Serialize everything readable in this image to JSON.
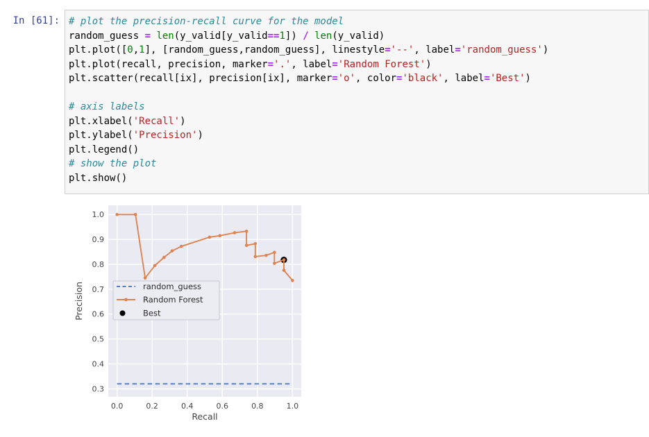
{
  "notebook": {
    "prompt": "In [61]:",
    "code_lines": [
      [
        {
          "t": "comment",
          "s": "# plot the precision-recall curve for the model"
        }
      ],
      [
        {
          "t": "plain",
          "s": "random_guess "
        },
        {
          "t": "op",
          "s": "="
        },
        {
          "t": "plain",
          "s": " "
        },
        {
          "t": "builtin",
          "s": "len"
        },
        {
          "t": "plain",
          "s": "(y_valid[y_valid"
        },
        {
          "t": "op",
          "s": "=="
        },
        {
          "t": "num",
          "s": "1"
        },
        {
          "t": "plain",
          "s": "]) "
        },
        {
          "t": "op",
          "s": "/"
        },
        {
          "t": "plain",
          "s": " "
        },
        {
          "t": "builtin",
          "s": "len"
        },
        {
          "t": "plain",
          "s": "(y_valid)"
        }
      ],
      [
        {
          "t": "plain",
          "s": "plt.plot(["
        },
        {
          "t": "num",
          "s": "0"
        },
        {
          "t": "plain",
          "s": ","
        },
        {
          "t": "num",
          "s": "1"
        },
        {
          "t": "plain",
          "s": "], [random_guess,random_guess], linestyle"
        },
        {
          "t": "op",
          "s": "="
        },
        {
          "t": "str",
          "s": "'--'"
        },
        {
          "t": "plain",
          "s": ", label"
        },
        {
          "t": "op",
          "s": "="
        },
        {
          "t": "str",
          "s": "'random_guess'"
        },
        {
          "t": "plain",
          "s": ")"
        }
      ],
      [
        {
          "t": "plain",
          "s": "plt.plot(recall, precision, marker"
        },
        {
          "t": "op",
          "s": "="
        },
        {
          "t": "str",
          "s": "'.'"
        },
        {
          "t": "plain",
          "s": ", label"
        },
        {
          "t": "op",
          "s": "="
        },
        {
          "t": "str",
          "s": "'Random Forest'"
        },
        {
          "t": "plain",
          "s": ")"
        }
      ],
      [
        {
          "t": "plain",
          "s": "plt.scatter(recall[ix], precision[ix], marker"
        },
        {
          "t": "op",
          "s": "="
        },
        {
          "t": "str",
          "s": "'o'"
        },
        {
          "t": "plain",
          "s": ", color"
        },
        {
          "t": "op",
          "s": "="
        },
        {
          "t": "str",
          "s": "'black'"
        },
        {
          "t": "plain",
          "s": ", label"
        },
        {
          "t": "op",
          "s": "="
        },
        {
          "t": "str",
          "s": "'Best'"
        },
        {
          "t": "plain",
          "s": ")"
        }
      ],
      [],
      [
        {
          "t": "comment",
          "s": "# axis labels"
        }
      ],
      [
        {
          "t": "plain",
          "s": "plt.xlabel("
        },
        {
          "t": "str",
          "s": "'Recall'"
        },
        {
          "t": "plain",
          "s": ")"
        }
      ],
      [
        {
          "t": "plain",
          "s": "plt.ylabel("
        },
        {
          "t": "str",
          "s": "'Precision'"
        },
        {
          "t": "plain",
          "s": ")"
        }
      ],
      [
        {
          "t": "plain",
          "s": "plt.legend()"
        }
      ],
      [
        {
          "t": "comment",
          "s": "# show the plot"
        }
      ],
      [
        {
          "t": "plain",
          "s": "plt.show()"
        }
      ]
    ]
  },
  "chart_data": {
    "type": "line",
    "title": "",
    "xlabel": "Recall",
    "ylabel": "Precision",
    "xlim": [
      -0.05,
      1.05
    ],
    "ylim": [
      0.268,
      1.037
    ],
    "x_ticks": [
      0.0,
      0.2,
      0.4,
      0.6,
      0.8,
      1.0
    ],
    "y_ticks": [
      0.3,
      0.4,
      0.5,
      0.6,
      0.7,
      0.8,
      0.9,
      1.0
    ],
    "grid": true,
    "axes_background": "#eaeaf2",
    "grid_color": "#ffffff",
    "tick_color": "#444444",
    "series": [
      {
        "name": "random_guess",
        "style": "dashed",
        "color": "#5a7fc2",
        "x": [
          0,
          1
        ],
        "y": [
          0.32,
          0.32
        ]
      },
      {
        "name": "Random Forest",
        "style": "line-marker",
        "color": "#dd8452",
        "points": [
          [
            0.0,
            1.0
          ],
          [
            0.105,
            1.0
          ],
          [
            0.16,
            0.745
          ],
          [
            0.215,
            0.795
          ],
          [
            0.268,
            0.828
          ],
          [
            0.314,
            0.854
          ],
          [
            0.366,
            0.872
          ],
          [
            0.527,
            0.909
          ],
          [
            0.586,
            0.915
          ],
          [
            0.67,
            0.927
          ],
          [
            0.738,
            0.933
          ],
          [
            0.738,
            0.876
          ],
          [
            0.788,
            0.883
          ],
          [
            0.788,
            0.831
          ],
          [
            0.85,
            0.836
          ],
          [
            0.897,
            0.848
          ],
          [
            0.897,
            0.804
          ],
          [
            0.951,
            0.818
          ],
          [
            0.951,
            0.776
          ],
          [
            1.0,
            0.735
          ]
        ]
      },
      {
        "name": "Best",
        "style": "dot",
        "color": "#000000",
        "points": [
          [
            0.951,
            0.818
          ]
        ]
      }
    ],
    "legend": {
      "position": "center-left",
      "entries": [
        {
          "label": "random_guess",
          "color": "#5a7fc2",
          "style": "dashed"
        },
        {
          "label": "Random Forest",
          "color": "#dd8452",
          "style": "line-marker"
        },
        {
          "label": "Best",
          "color": "#000000",
          "style": "dot"
        }
      ]
    }
  }
}
